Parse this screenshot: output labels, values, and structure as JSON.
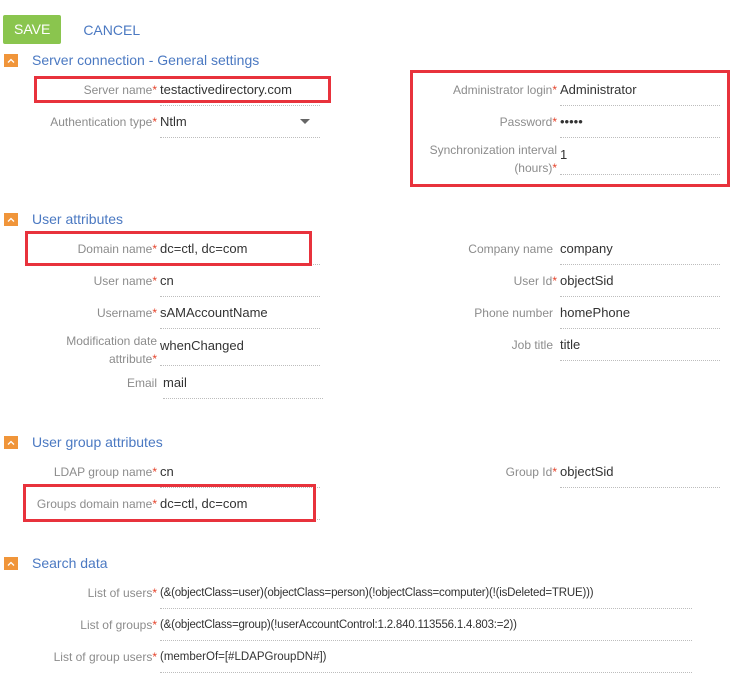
{
  "toolbar": {
    "save_label": "SAVE",
    "cancel_label": "CANCEL"
  },
  "colors": {
    "save_bg": "#8ac54e",
    "link": "#4b79c2",
    "section_icon": "#f0953a",
    "required": "#e5432b",
    "highlight": "#e8323c"
  },
  "sections": {
    "server": {
      "title": "Server connection - General settings",
      "fields": {
        "server_name": {
          "label": "Server name",
          "value": "testactivedirectory.com"
        },
        "auth_type": {
          "label": "Authentication type",
          "value": "Ntlm"
        },
        "admin_login": {
          "label": "Administrator login",
          "value": "Administrator"
        },
        "password": {
          "label": "Password",
          "value": "•••••"
        },
        "sync_interval": {
          "label_line1": "Synchronization interval",
          "label_line2": "(hours)",
          "value": "1"
        }
      }
    },
    "user_attrs": {
      "title": "User attributes",
      "fields": {
        "domain_name": {
          "label": "Domain name",
          "value": "dc=ctl, dc=com"
        },
        "user_name": {
          "label": "User name",
          "value": "cn"
        },
        "username": {
          "label": "Username",
          "value": "sAMAccountName"
        },
        "mod_date": {
          "label_line1": "Modification date",
          "label_line2": "attribute",
          "value": "whenChanged"
        },
        "email": {
          "label": "Email",
          "value": "mail"
        },
        "company_name": {
          "label": "Company name",
          "value": "company"
        },
        "user_id": {
          "label": "User Id",
          "value": "objectSid"
        },
        "phone": {
          "label": "Phone number",
          "value": "homePhone"
        },
        "job_title": {
          "label": "Job title",
          "value": "title"
        }
      }
    },
    "group_attrs": {
      "title": "User group attributes",
      "fields": {
        "ldap_group_name": {
          "label": "LDAP group name",
          "value": "cn"
        },
        "groups_domain": {
          "label": "Groups domain name",
          "value": "dc=ctl, dc=com"
        },
        "group_id": {
          "label": "Group Id",
          "value": "objectSid"
        }
      }
    },
    "search": {
      "title": "Search data",
      "fields": {
        "list_users": {
          "label": "List of users",
          "value": "(&(objectClass=user)(objectClass=person)(!objectClass=computer)(!(isDeleted=TRUE)))"
        },
        "list_groups": {
          "label": "List of groups",
          "value": "(&(objectClass=group)(!userAccountControl:1.2.840.113556.1.4.803:=2))"
        },
        "list_group_users": {
          "label": "List of group users",
          "value": "(memberOf=[#LDAPGroupDN#])"
        }
      }
    }
  },
  "required_mark": "*",
  "icons": {
    "section_toggle": "chevron-up-icon",
    "dropdown": "caret-down-icon"
  }
}
